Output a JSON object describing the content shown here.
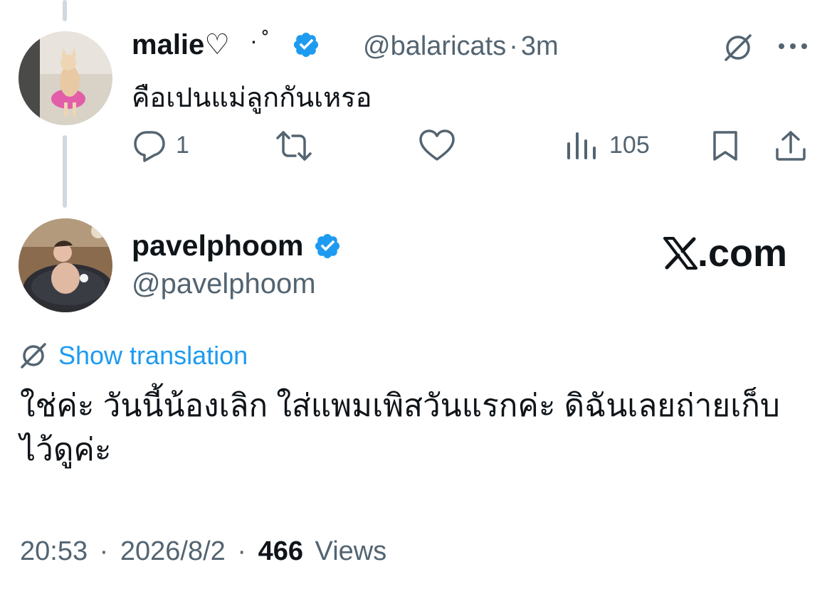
{
  "reply": {
    "display_name": "malie♡",
    "name_decoration": "·˚",
    "handle": "@balaricats",
    "separator": "·",
    "time_ago": "3m",
    "text": "คือเปนแม่ลูกกันเหรอ",
    "verified": true,
    "actions": {
      "reply_count": "1",
      "views_count": "105"
    }
  },
  "tweet": {
    "display_name": "pavelphoom",
    "handle": "@pavelphoom",
    "verified": true,
    "brand": ".com",
    "show_translation_label": "Show translation",
    "text": "ใช่ค่ะ วันนี้น้องเลิก ใส่แพมเพิสวันแรกค่ะ ดิฉันเลยถ่ายเก็บไว้ดูค่ะ",
    "time": "20:53",
    "date": "2026/8/2",
    "views_count": "466",
    "views_label": "Views",
    "separator": "·"
  },
  "colors": {
    "text": "#0f1419",
    "muted": "#536471",
    "accent": "#1d9bf0",
    "thread_line": "#cfd9de"
  },
  "icons": {
    "translate": "translate-icon",
    "more": "more-icon",
    "reply": "reply-icon",
    "repost": "repost-icon",
    "like": "like-icon",
    "views": "views-icon",
    "bookmark": "bookmark-icon",
    "share": "share-icon",
    "verified": "verified-badge-icon"
  }
}
